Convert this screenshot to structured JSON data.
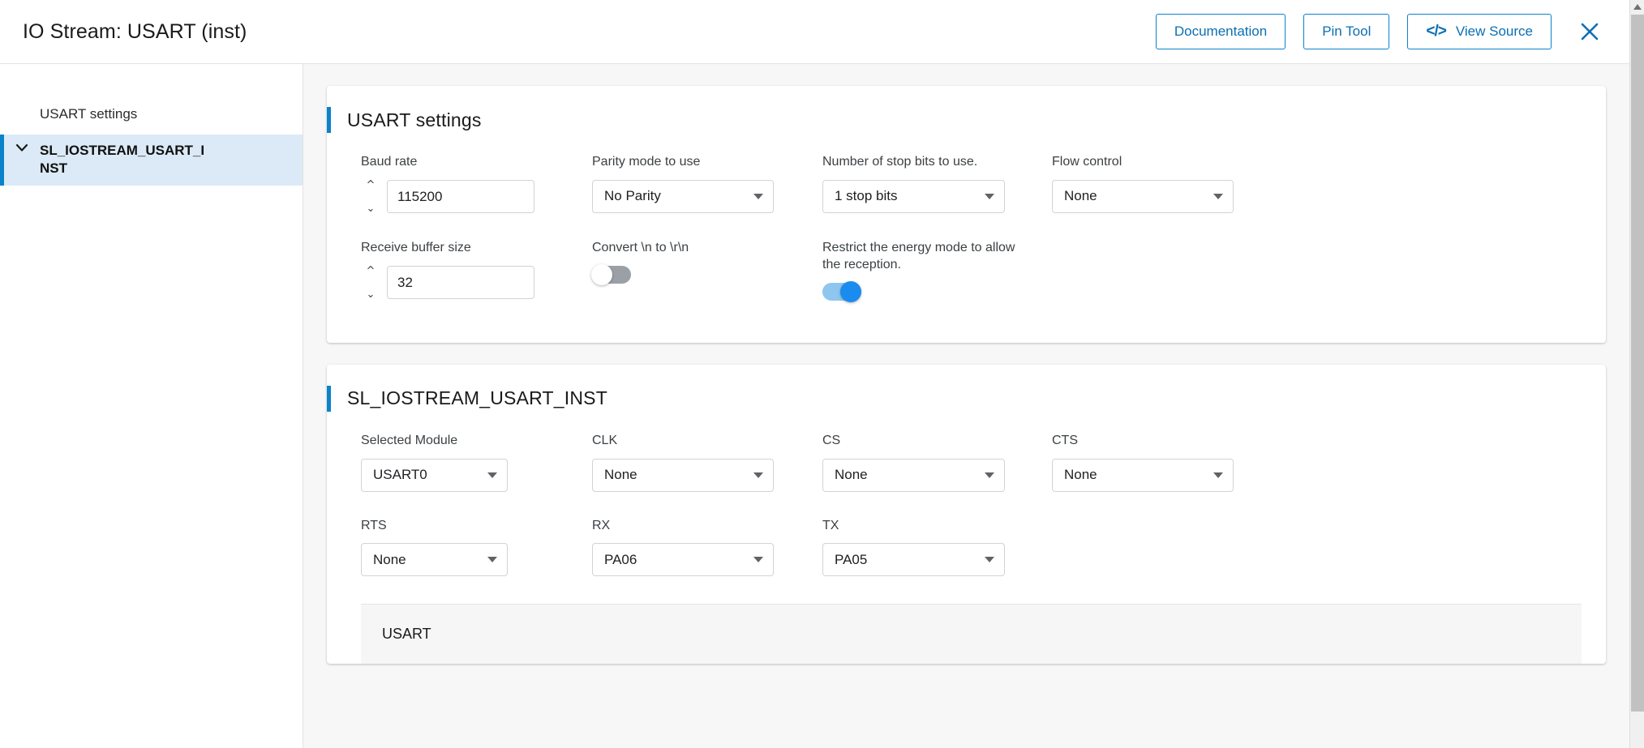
{
  "header": {
    "title": "IO Stream: USART (inst)",
    "buttons": [
      {
        "label": "Documentation",
        "icon": ""
      },
      {
        "label": "Pin Tool",
        "icon": ""
      },
      {
        "label": "View Source",
        "icon": "code-icon",
        "icon_glyph": "</>"
      }
    ],
    "close_label": "close-icon"
  },
  "sidebar": {
    "collapse_glyph": "«",
    "items": [
      {
        "label": "USART settings",
        "selected": false,
        "chevron": ""
      },
      {
        "label": "SL_IOSTREAM_USART_INST",
        "selected": true,
        "chevron": "⌄"
      }
    ]
  },
  "cards": [
    {
      "title": "USART settings",
      "fields": [
        {
          "label": "Baud rate",
          "type": "number",
          "value": "115200"
        },
        {
          "label": "Parity mode to use",
          "type": "select",
          "value": "No Parity"
        },
        {
          "label": "Number of stop bits to use.",
          "type": "select",
          "value": "1 stop bits"
        },
        {
          "label": "Flow control",
          "type": "select",
          "value": "None"
        },
        {
          "label": "Receive buffer size",
          "type": "number",
          "value": "32"
        },
        {
          "label": "Convert \\n to \\r\\n",
          "type": "toggle",
          "value": "off"
        },
        {
          "label": "Restrict the energy mode to allow the reception.",
          "type": "toggle",
          "value": "on"
        }
      ]
    },
    {
      "title": "SL_IOSTREAM_USART_INST",
      "fields": [
        {
          "label": "Selected Module",
          "type": "select",
          "value": "USART0"
        },
        {
          "label": "CLK",
          "type": "select",
          "value": "None"
        },
        {
          "label": "CS",
          "type": "select",
          "value": "None"
        },
        {
          "label": "CTS",
          "type": "select",
          "value": "None"
        },
        {
          "label": "RTS",
          "type": "select",
          "value": "None"
        },
        {
          "label": "RX",
          "type": "select",
          "value": "PA06"
        },
        {
          "label": "TX",
          "type": "select",
          "value": "PA05"
        }
      ],
      "sub_panel": {
        "title": "USART"
      }
    }
  ],
  "colors": {
    "accent_blue": "#0b82ca",
    "button_blue": "#0b6fb3",
    "selected_row_bg": "#dbeaf6",
    "toggle_on_track": "#8fc6ef",
    "toggle_on_knob": "#1a8cf0",
    "toggle_off_track": "#9aa0a6",
    "page_bg": "#f7f7f7"
  }
}
